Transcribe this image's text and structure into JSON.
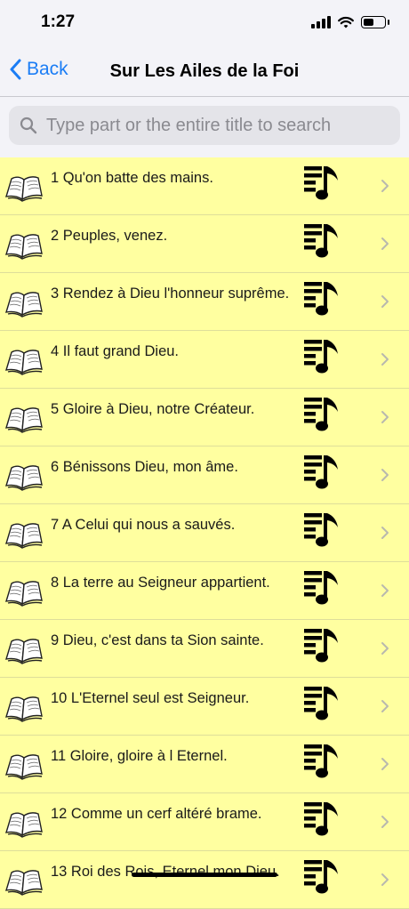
{
  "status": {
    "time": "1:27"
  },
  "nav": {
    "back_label": "Back",
    "title": "Sur Les Ailes de la Foi"
  },
  "search": {
    "placeholder": "Type part or the entire title to search",
    "value": ""
  },
  "items": [
    {
      "label": "1 Qu'on batte des mains."
    },
    {
      "label": "2 Peuples, venez."
    },
    {
      "label": "3 Rendez à Dieu l'honneur suprême."
    },
    {
      "label": "4 Il faut grand Dieu."
    },
    {
      "label": "5 Gloire à Dieu, notre Créateur."
    },
    {
      "label": "6 Bénissons Dieu, mon âme."
    },
    {
      "label": "7 A Celui qui nous a sauvés."
    },
    {
      "label": "8 La terre au Seigneur appartient."
    },
    {
      "label": "9 Dieu, c'est dans ta Sion sainte."
    },
    {
      "label": "10 L'Eternel seul est Seigneur."
    },
    {
      "label": "11 Gloire, gloire à l Eternel."
    },
    {
      "label": "12 Comme un cerf altéré brame."
    },
    {
      "label": "13 Roi des Rois, Eternel mon Dieu."
    }
  ],
  "colors": {
    "accent": "#1b7df5",
    "list_bg": "#ffffa0",
    "nav_bg": "#f3f3f8"
  },
  "icons": {
    "row_left": "open-book-icon",
    "row_right": "playlist-music-icon",
    "disclosure": "chevron-right-icon"
  }
}
